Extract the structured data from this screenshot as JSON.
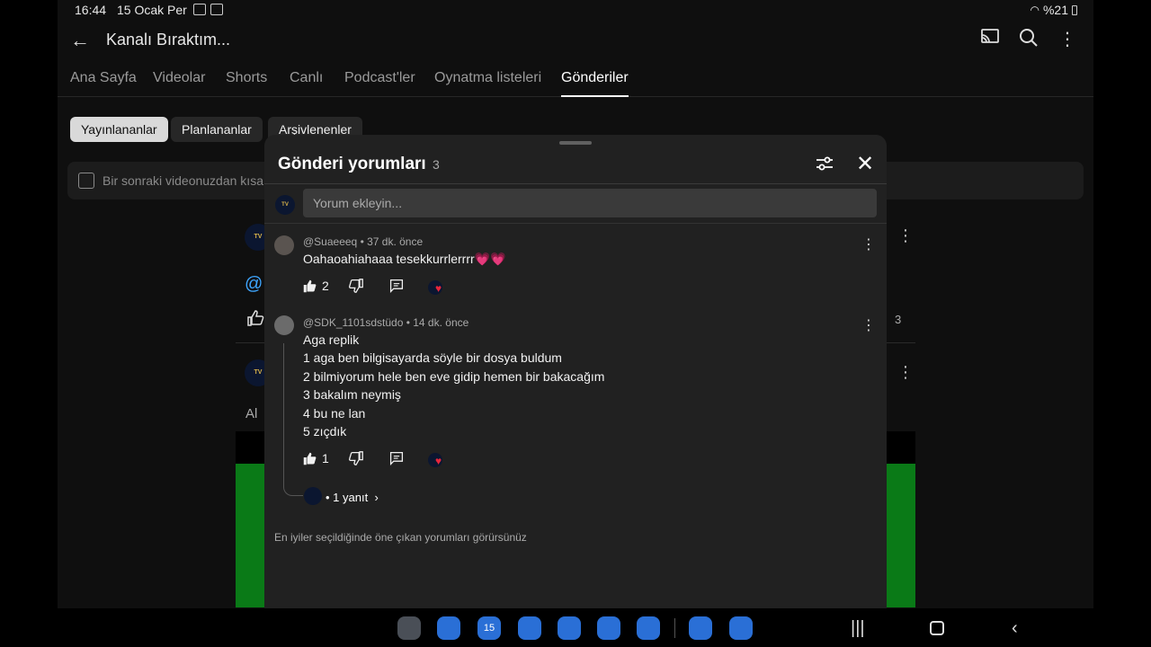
{
  "statusbar": {
    "time": "16:44",
    "date": "15 Ocak Per",
    "battery": "%21"
  },
  "appbar": {
    "title": "Kanalı Bıraktım..."
  },
  "tabs": [
    "Ana Sayfa",
    "Videolar",
    "Shorts",
    "Canlı",
    "Podcast'ler",
    "Oynatma listeleri",
    "Gönderiler"
  ],
  "active_tab": "Gönderiler",
  "chips": [
    "Yayınlananlar",
    "Planlananlar",
    "Arşivlenenler"
  ],
  "post_input": {
    "placeholder": "Bir sonraki videonuzdan kısa"
  },
  "background": {
    "at_sign": "@",
    "al_text": "Al",
    "like_count": "3"
  },
  "sheet": {
    "title": "Gönderi yorumları",
    "count": "3",
    "input_placeholder": "Yorum ekleyin...",
    "comments": [
      {
        "author": "@Suaeeeq",
        "time": "37 dk. önce",
        "text": "Oahaoahiahaaa tesekkurrlerrrr💗💗",
        "likes": "2"
      },
      {
        "author": "@SDK_1101sdstüdo",
        "time": "14 dk. önce",
        "lines": [
          "Aga replik",
          "1 aga ben bilgisayarda söyle bir dosya buldum",
          "2 bilmiyorum hele ben eve gidip hemen bir bakacağım",
          "3 bakalım neymiş",
          "4 bu ne lan",
          "5 zıçdık"
        ],
        "likes": "1",
        "replies": "• 1 yanıt"
      }
    ],
    "footer_note": "En iyiler seçildiğinde öne çıkan yorumları görürsünüz"
  },
  "taskbar": {
    "apps": [
      "app-drawer-icon",
      "files-icon",
      "calendar-icon",
      "messages-icon",
      "contacts-icon",
      "camera-icon",
      "apps-grid-icon",
      "instagram-icon",
      "whatsapp-icon"
    ],
    "calendar_day": "15"
  },
  "colors": {
    "accent_green": "#0a7a17",
    "heart": "#e8263c",
    "sheet_bg": "#212121"
  }
}
